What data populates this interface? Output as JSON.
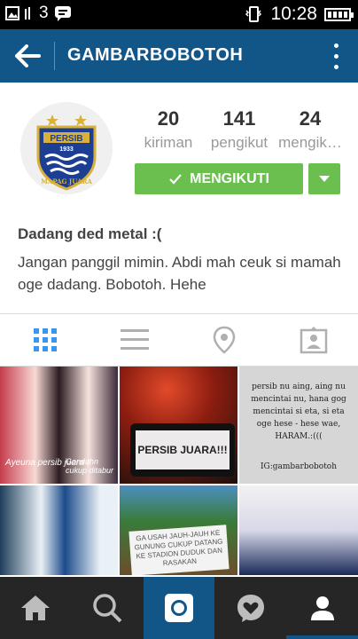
{
  "status_bar": {
    "signal_count": "3",
    "time": "10:28"
  },
  "app_bar": {
    "title": "GAMBARBOBOTOH"
  },
  "profile": {
    "avatar": {
      "club": "PERSIB",
      "year": "1933",
      "motto": "MAPAG JUARA"
    },
    "stats": [
      {
        "count": "20",
        "label": "kiriman"
      },
      {
        "count": "141",
        "label": "pengikut"
      },
      {
        "count": "24",
        "label": "mengik…"
      }
    ],
    "follow_button_label": "MENGIKUTI",
    "name": "Dadang ded metal :(",
    "bio": "Jangan panggil mimin. Abdi mah ceuk si mamah oge dadang. Bobotoh. Hehe"
  },
  "tabs": [
    "grid-view",
    "list-view",
    "photo-map",
    "tagged-photos"
  ],
  "grid_captions": {
    "post1_a": "Ayeuna persib juara !!",
    "post1_b": "Gonduhn cukup ditabur",
    "post2": "PERSIB JUARA!!!",
    "post3_text": "persib nu aing, aing nu mencintai nu, hana gog mencintai si eta, si eta oge hese - hese wae, HARAM.:(((",
    "post3_tag": "IG:gambarbobotoh",
    "post5": "GA USAH JAUH-JAUH KE GUNUNG CUKUP DATANG KE STADION DUDUK DAN RASAKAN"
  },
  "bottom_nav": [
    "home",
    "search",
    "camera",
    "activity",
    "profile"
  ],
  "colors": {
    "primary": "#125688",
    "follow_green": "#6bbf4e",
    "nav_dark": "#262626"
  }
}
